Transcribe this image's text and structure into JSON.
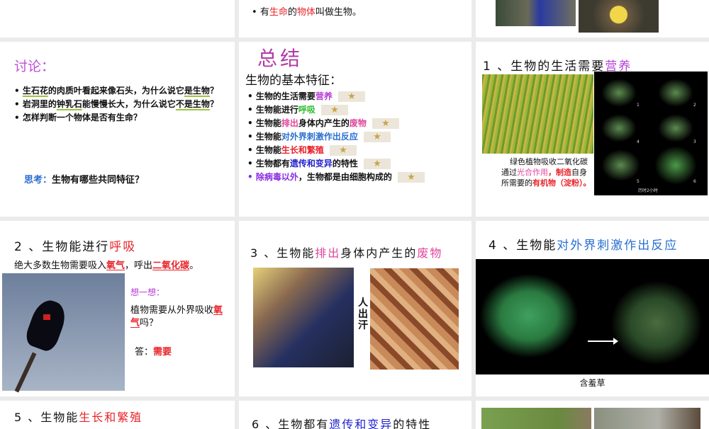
{
  "slides": [
    {
      "id": "intro-a"
    },
    {
      "id": "intro-b",
      "bullet_parts": [
        "有",
        "生命",
        "的",
        "物体",
        "叫做生物。"
      ]
    },
    {
      "id": "intro-c"
    },
    {
      "id": "discussion",
      "title": "讨论：",
      "q1": [
        "生石花",
        "的肉质叶看起来像石头，为什么说它",
        "是生物",
        "？"
      ],
      "q2": [
        "岩洞里的",
        "钟乳石",
        "能慢慢长大，为什么说它",
        "不是生物",
        "？"
      ],
      "q3": "怎样判断一个物体是否有生命？",
      "think_label": "思考：",
      "think_text": "生物有哪些共同特征？"
    },
    {
      "id": "summary",
      "title": "总结",
      "subtitle": "生物的基本特征：",
      "items": [
        {
          "pre": "生物的生活需要",
          "hl": "营养",
          "post": ""
        },
        {
          "pre": "生物能进行",
          "hl": "呼吸",
          "post": ""
        },
        {
          "pre": "生物能",
          "hl": "排出",
          "mid": "身体内产生的",
          "hl2": "废物"
        },
        {
          "pre": "生物能",
          "hl": "对外界刺激作出反应",
          "post": ""
        },
        {
          "pre": "生物能",
          "hl": "生长和繁殖",
          "post": ""
        },
        {
          "pre": "生物都有",
          "hl": "遗传和变异",
          "post": "的特性"
        },
        {
          "pre": "",
          "hl": "除病毒以外",
          "post": "，生物都是由细胞构成的"
        }
      ],
      "star_icon": "star-icon"
    },
    {
      "id": "nutrition",
      "title_pre": "1 、生物的生活需要",
      "title_hl": "营养",
      "caption": [
        "绿色植物吸收二氧化碳通过",
        "光合作用",
        "，",
        "制造",
        "自身所需要的",
        "有机物（淀粉）。"
      ],
      "photo_labels": [
        "1",
        "2",
        "4",
        "3",
        "5",
        "6"
      ],
      "photo_caption": "历时2小时"
    },
    {
      "id": "respiration",
      "title_pre": "2 、生物能进行",
      "title_hl": "呼吸",
      "line": [
        "绝大多数生物需要吸入",
        "氧气",
        "，呼出",
        "二氧化碳",
        "。"
      ],
      "think": "想一想：",
      "question": [
        "植物需要从外界吸收",
        "氧气",
        "吗？"
      ],
      "answer_label": "答：",
      "answer": "需要"
    },
    {
      "id": "excretion",
      "title_pre": "3 、生物能",
      "title_hl": "排出",
      "title_mid": "身体内产生的",
      "title_hl2": "废物",
      "side_label": "人出汗"
    },
    {
      "id": "stimulus",
      "title_pre": "4 、生物能",
      "title_hl": "对外界刺激作出反应",
      "caption": "含羞草"
    },
    {
      "id": "growth",
      "title_pre": "5 、生物能",
      "title_hl": "生长和繁殖"
    },
    {
      "id": "heredity",
      "title_pre": "6 、生物都有",
      "title_hl": "遗传和变异",
      "title_post": "的特性"
    },
    {
      "id": "photos"
    }
  ],
  "colors": {
    "background": "#ebebeb",
    "red": "#e8242a",
    "pink": "#e0449c",
    "purple": "#b53fd6",
    "blue": "#2a6fd0"
  }
}
